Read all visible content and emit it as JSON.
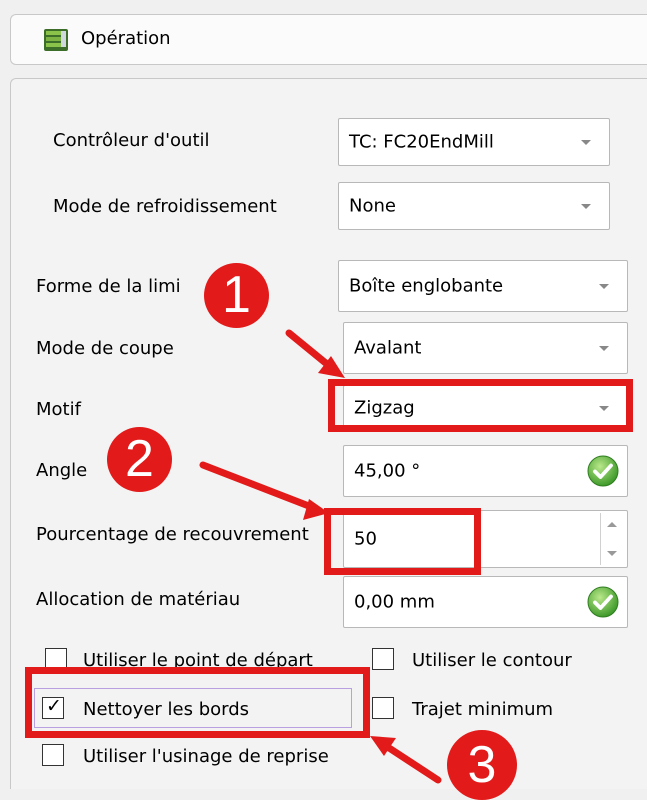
{
  "header": {
    "title": "Opération",
    "icon": "operation-icon"
  },
  "form": {
    "tool_controller": {
      "label": "Contrôleur d'outil",
      "value": "TC: FC20EndMill"
    },
    "coolant_mode": {
      "label": "Mode de refroidissement",
      "value": "None"
    },
    "boundary_shape": {
      "label": "Forme de la limi",
      "value": "Boîte englobante"
    },
    "cut_mode": {
      "label": "Mode de coupe",
      "value": "Avalant"
    },
    "pattern": {
      "label": "Motif",
      "value": "Zigzag"
    },
    "angle": {
      "label": "Angle",
      "value": "45,00 °"
    },
    "step_over": {
      "label": "Pourcentage de recouvrement",
      "value": "50"
    },
    "material_allowance": {
      "label": "Allocation de matériau",
      "value": "0,00 mm"
    },
    "checkboxes": {
      "use_start_point": {
        "label": "Utiliser le point de départ",
        "checked": false
      },
      "use_outline": {
        "label": "Utiliser le contour",
        "checked": false
      },
      "clear_edges": {
        "label": "Nettoyer les bords",
        "checked": true,
        "mark": "✓"
      },
      "min_travel": {
        "label": "Trajet minimum",
        "checked": false
      },
      "use_rest_machining": {
        "label": "Utiliser l'usinage de reprise",
        "checked": false
      }
    }
  },
  "annotations": {
    "badges": [
      "1",
      "2",
      "3"
    ],
    "color": "#e21a1a"
  }
}
